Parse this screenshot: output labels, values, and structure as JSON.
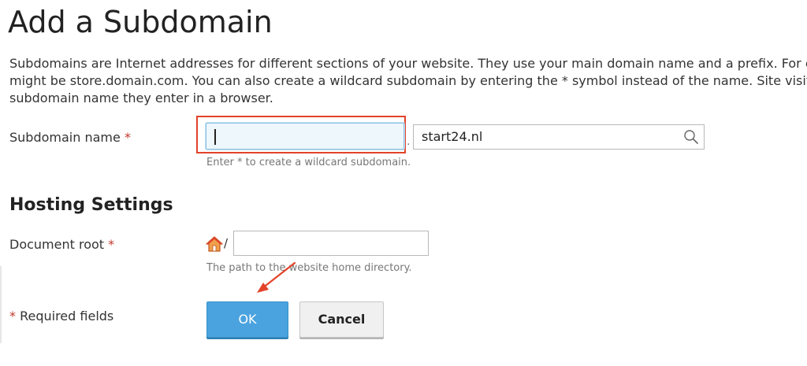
{
  "title": "Add a Subdomain",
  "intro_lines": [
    "Subdomains are Internet addresses for different sections of your website. They use your main domain name and a prefix. For example,",
    "might be store.domain.com. You can also create a wildcard subdomain by entering the * symbol instead of the name. Site visitors will be",
    "subdomain name they enter in a browser."
  ],
  "subdomain": {
    "label": "Subdomain name",
    "required_mark": "*",
    "value": "",
    "separator": ".",
    "domain": "start24.nl",
    "hint": "Enter * to create a wildcard subdomain."
  },
  "hosting": {
    "section_title": "Hosting Settings",
    "docroot_label": "Document root",
    "required_mark": "*",
    "path_prefix": "/",
    "value": "",
    "hint": "The path to the website home directory."
  },
  "footer": {
    "required_mark": "*",
    "required_text": "Required fields"
  },
  "buttons": {
    "ok": "OK",
    "cancel": "Cancel"
  },
  "colors": {
    "accent": "#4aa3df",
    "highlight": "#e2432a",
    "required": "#c0392b"
  }
}
